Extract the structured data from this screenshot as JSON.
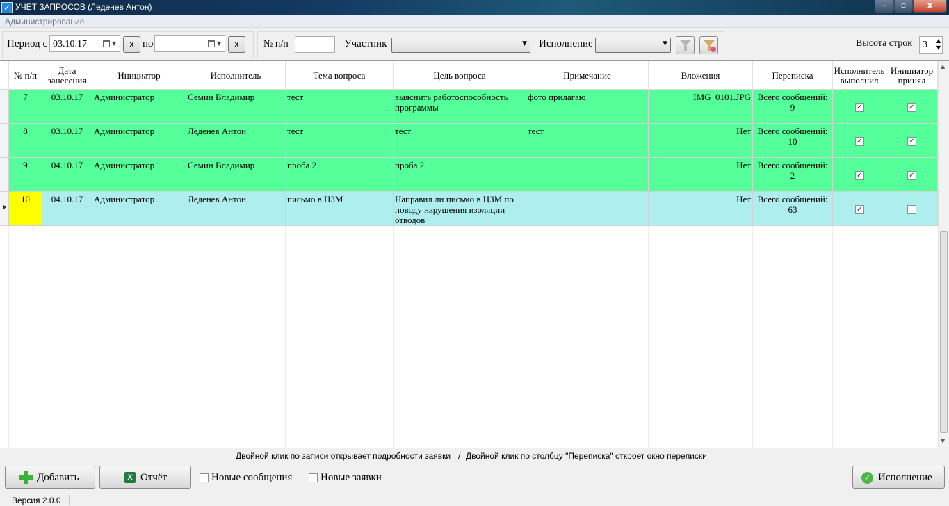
{
  "window": {
    "title": "УЧЁТ ЗАПРОСОВ (Леденев Антон)",
    "icon": "check-app-icon",
    "controls": {
      "minimize": "–",
      "maximize": "▫",
      "close": "x"
    }
  },
  "menu": {
    "items": [
      "Администрирование"
    ]
  },
  "toolbar": {
    "period_label": "Период с",
    "date_from": "03.10.17",
    "clear_label": "x",
    "to_label": "по",
    "date_to": "",
    "number_label": "№ п/п",
    "number_value": "",
    "participant_label": "Участник",
    "participant_value": "",
    "execution_label": "Исполнение",
    "execution_value": "",
    "apply_filter_icon": "funnel-icon",
    "clear_filter_icon": "funnel-clear-icon",
    "row_height_label": "Высота строк",
    "row_height_value": "3"
  },
  "table": {
    "columns": [
      "№ п/п",
      "Дата занесения",
      "Инициатор",
      "Исполнитель",
      "Тема вопроса",
      "Цель вопроса",
      "Примечание",
      "Вложения",
      "Переписка",
      "Исполнитель выполнил",
      "Инициатор принял"
    ],
    "rows": [
      {
        "num": "7",
        "date": "03.10.17",
        "initiator": "Администратор",
        "executor": "Семин Владимир",
        "topic": "тест",
        "goal": "выяснить работоспособность программы",
        "note": "фото прилагаю",
        "attachments": "IMG_0101.JPG",
        "messages": "Всего сообщений: 9",
        "executor_done": true,
        "initiator_accepted": true,
        "color": "green",
        "selected": false
      },
      {
        "num": "8",
        "date": "03.10.17",
        "initiator": "Администратор",
        "executor": "Леденев Антон",
        "topic": "тест",
        "goal": "тест",
        "note": "тест",
        "attachments": "Нет",
        "messages": "Всего сообщений: 10",
        "executor_done": true,
        "initiator_accepted": true,
        "color": "green",
        "selected": false
      },
      {
        "num": "9",
        "date": "04.10.17",
        "initiator": "Администратор",
        "executor": "Семин Владимир",
        "topic": "проба 2",
        "goal": "проба 2",
        "note": "",
        "attachments": "Нет",
        "messages": "Всего сообщений: 2",
        "executor_done": true,
        "initiator_accepted": true,
        "color": "green",
        "selected": false
      },
      {
        "num": "10",
        "date": "04.10.17",
        "initiator": "Администратор",
        "executor": "Леденев Антон",
        "topic": "письмо в ЦЗМ",
        "goal": "Направил ли письмо в ЦЗМ по поводу нарушения изоляции отводов",
        "note": "",
        "attachments": "Нет",
        "messages": "Всего сообщений: 63",
        "executor_done": true,
        "initiator_accepted": false,
        "color": "cyan",
        "selected": true
      }
    ],
    "row_colors": {
      "green": "#55ff99",
      "cyan": "#afeeee",
      "current_num": "#ffff00"
    }
  },
  "hint": {
    "left": "Двойной клик по записи открывает подробности заявки",
    "separator": "/",
    "right": "Двойной клик по столбцу \"Переписка\"  откроет окно переписки"
  },
  "bottom": {
    "add_label": "Добавить",
    "add_icon": "plus-icon",
    "report_label": "Отчёт",
    "report_icon": "excel-icon",
    "new_messages_label": "Новые сообщения",
    "new_requests_label": "Новые заявки",
    "execution_button_label": "Исполнение",
    "execution_icon": "checkmark-icon"
  },
  "status": {
    "version": "Версия 2.0.0"
  }
}
